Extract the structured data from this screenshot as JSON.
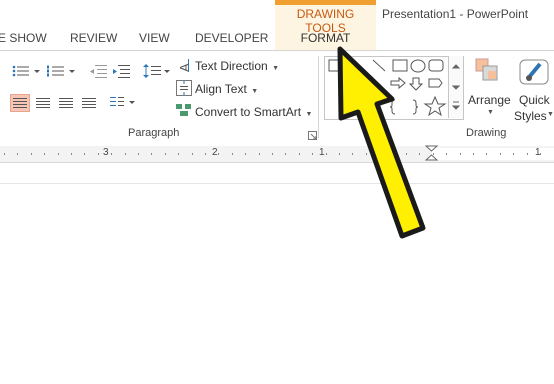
{
  "app": {
    "window_title": "Presentation1 - PowerPoint",
    "contextual_group": "DRAWING TOOLS"
  },
  "tabs": [
    {
      "label": "E SHOW"
    },
    {
      "label": "REVIEW"
    },
    {
      "label": "VIEW"
    },
    {
      "label": "DEVELOPER"
    },
    {
      "label": "FORMAT",
      "active": true
    }
  ],
  "paragraph_group": {
    "label": "Paragraph",
    "text_direction": "Text Direction",
    "align_text": "Align Text",
    "convert_smartart": "Convert to SmartArt"
  },
  "drawing_group": {
    "label": "Drawing",
    "arrange": "Arrange",
    "quick_styles_line1": "Quick",
    "quick_styles_line2": "Styles"
  },
  "ruler": {
    "labels": [
      "3",
      "2",
      "1",
      "1"
    ]
  },
  "icons": {
    "bullets": "bullets-icon",
    "numbering": "numbering-icon",
    "decrease_indent": "decrease-indent-icon",
    "increase_indent": "increase-indent-icon",
    "line_spacing": "line-spacing-icon",
    "columns": "columns-icon",
    "dialog_launcher": "dialog-launcher-icon",
    "arrow": "yellow-arrow-annotation"
  },
  "colors": {
    "contextual_accent": "#f0a030",
    "contextual_text": "#c55a11",
    "contextual_band": "#fdf4e2",
    "selected_align": "#f5c6b6",
    "arrow_fill": "#ffef00"
  }
}
